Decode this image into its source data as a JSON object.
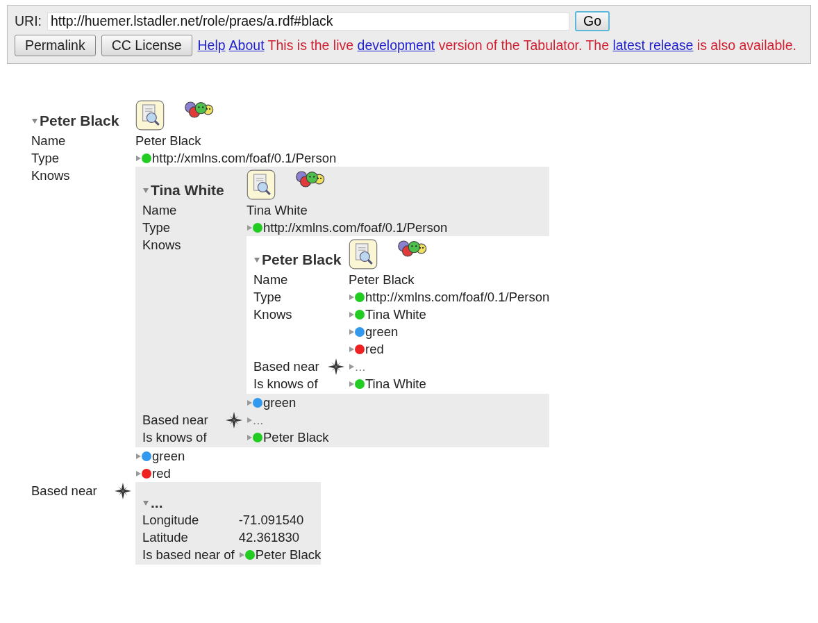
{
  "uri_bar": {
    "label": "URI:",
    "value": "http://huemer.lstadler.net/role/praes/a.rdf#black",
    "go_button": "Go"
  },
  "toolbar": {
    "buttons": [
      "Permalink",
      "CC License"
    ],
    "links": [
      "Help",
      "About"
    ],
    "notice": [
      {
        "kind": "text",
        "text": "This is the live "
      },
      {
        "kind": "link",
        "text": "development"
      },
      {
        "kind": "text",
        "text": " version of the Tabulator. The "
      },
      {
        "kind": "link",
        "text": "latest release"
      },
      {
        "kind": "text",
        "text": " is also available."
      }
    ]
  },
  "tree": {
    "kind": "resource",
    "expanded": true,
    "label": "Peter Black",
    "tools": true,
    "properties": [
      {
        "label": "Name",
        "compass": false,
        "values": [
          {
            "kind": "text",
            "text": "Peter Black"
          }
        ]
      },
      {
        "label": "Type",
        "compass": false,
        "values": [
          {
            "kind": "resource",
            "expanded": false,
            "color": "#22cc22",
            "label": "http://xmlns.com/foaf/0.1/Person"
          }
        ]
      },
      {
        "label": "Knows",
        "compass": false,
        "values": [
          {
            "kind": "resource",
            "expanded": true,
            "label": "Tina White",
            "tools": true,
            "properties": [
              {
                "label": "Name",
                "compass": false,
                "values": [
                  {
                    "kind": "text",
                    "text": "Tina White"
                  }
                ]
              },
              {
                "label": "Type",
                "compass": false,
                "values": [
                  {
                    "kind": "resource",
                    "expanded": false,
                    "color": "#22cc22",
                    "label": "http://xmlns.com/foaf/0.1/Person"
                  }
                ]
              },
              {
                "label": "Knows",
                "compass": false,
                "values": [
                  {
                    "kind": "resource",
                    "expanded": true,
                    "label": "Peter Black",
                    "tools": true,
                    "properties": [
                      {
                        "label": "Name",
                        "compass": false,
                        "values": [
                          {
                            "kind": "text",
                            "text": "Peter Black"
                          }
                        ]
                      },
                      {
                        "label": "Type",
                        "compass": false,
                        "values": [
                          {
                            "kind": "resource",
                            "expanded": false,
                            "color": "#22cc22",
                            "label": "http://xmlns.com/foaf/0.1/Person"
                          }
                        ]
                      },
                      {
                        "label": "Knows",
                        "compass": false,
                        "values": [
                          {
                            "kind": "resource",
                            "expanded": false,
                            "color": "#22cc22",
                            "label": "Tina White"
                          },
                          {
                            "kind": "resource",
                            "expanded": false,
                            "color": "#3399ee",
                            "label": "green"
                          },
                          {
                            "kind": "resource",
                            "expanded": false,
                            "color": "#ee2222",
                            "label": "red"
                          }
                        ]
                      },
                      {
                        "label": "Based near",
                        "compass": true,
                        "values": [
                          {
                            "kind": "resource",
                            "expanded": false,
                            "label": "..."
                          }
                        ]
                      },
                      {
                        "label": "Is knows of",
                        "compass": false,
                        "values": [
                          {
                            "kind": "resource",
                            "expanded": false,
                            "color": "#22cc22",
                            "label": "Tina White"
                          }
                        ]
                      }
                    ]
                  },
                  {
                    "kind": "resource",
                    "expanded": false,
                    "color": "#3399ee",
                    "label": "green"
                  }
                ]
              },
              {
                "label": "Based near",
                "compass": true,
                "values": [
                  {
                    "kind": "resource",
                    "expanded": false,
                    "label": "..."
                  }
                ]
              },
              {
                "label": "Is knows of",
                "compass": false,
                "values": [
                  {
                    "kind": "resource",
                    "expanded": false,
                    "color": "#22cc22",
                    "label": "Peter Black"
                  }
                ]
              }
            ]
          },
          {
            "kind": "resource",
            "expanded": false,
            "color": "#3399ee",
            "label": "green"
          },
          {
            "kind": "resource",
            "expanded": false,
            "color": "#ee2222",
            "label": "red"
          }
        ]
      },
      {
        "label": "Based near",
        "compass": true,
        "values": [
          {
            "kind": "resource",
            "expanded": true,
            "label": "...",
            "tools": false,
            "properties": [
              {
                "label": "Longitude",
                "compass": false,
                "values": [
                  {
                    "kind": "text",
                    "text": "-71.091540"
                  }
                ]
              },
              {
                "label": "Latitude",
                "compass": false,
                "values": [
                  {
                    "kind": "text",
                    "text": "42.361830"
                  }
                ]
              },
              {
                "label": "Is based near of",
                "compass": false,
                "values": [
                  {
                    "kind": "resource",
                    "expanded": false,
                    "color": "#22cc22",
                    "label": "Peter Black"
                  }
                ]
              }
            ]
          }
        ]
      }
    ]
  }
}
